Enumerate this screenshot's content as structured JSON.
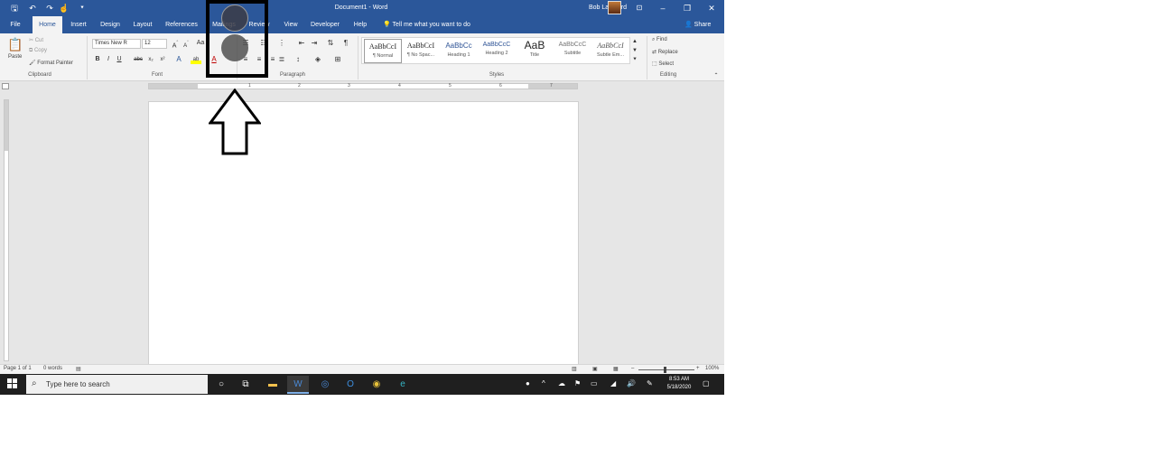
{
  "window": {
    "doc_title": "Document1  -  Word",
    "user_name": "Bob LanMord",
    "controls": {
      "minimize": "–",
      "restore": "❐",
      "close": "✕"
    }
  },
  "qat": {
    "save": "🖫",
    "undo": "↶",
    "redo": "↷",
    "touch": "☝",
    "customize": "⯆"
  },
  "tabs": [
    {
      "label": "File"
    },
    {
      "label": "Home"
    },
    {
      "label": "Insert"
    },
    {
      "label": "Design"
    },
    {
      "label": "Layout"
    },
    {
      "label": "References"
    },
    {
      "label": "Mailings"
    },
    {
      "label": "Review"
    },
    {
      "label": "View"
    },
    {
      "label": "Developer"
    },
    {
      "label": "Help"
    }
  ],
  "tell_me": "Tell me what you want to do",
  "share": "Share",
  "ribbon": {
    "clipboard": {
      "label": "Clipboard",
      "paste": "Paste",
      "cut": "Cut",
      "copy": "Copy",
      "format_painter": "Format Painter"
    },
    "font": {
      "label": "Font",
      "font_name": "Times New R",
      "font_size": "12",
      "bold": "B",
      "italic": "I",
      "underline": "U",
      "strike": "abc",
      "subscript": "x₂",
      "superscript": "x²"
    },
    "paragraph": {
      "label": "Paragraph"
    },
    "styles": {
      "label": "Styles",
      "items": [
        {
          "sample": "AaBbCcI",
          "name": "¶ Normal"
        },
        {
          "sample": "AaBbCcI",
          "name": "¶ No Spac..."
        },
        {
          "sample": "AaBbCc",
          "name": "Heading 1"
        },
        {
          "sample": "AaBbCcC",
          "name": "Heading 2"
        },
        {
          "sample": "AaB",
          "name": "Title"
        },
        {
          "sample": "AaBbCcC",
          "name": "Subtitle"
        },
        {
          "sample": "AaBbCcI",
          "name": "Subtle Em..."
        }
      ]
    },
    "editing": {
      "label": "Editing",
      "find": "Find",
      "replace": "Replace",
      "select": "Select"
    }
  },
  "ruler_numbers": [
    "1",
    "2",
    "3",
    "4",
    "5",
    "6",
    "7"
  ],
  "status": {
    "page": "Page 1 of 1",
    "words": "0 words",
    "zoom": "100%",
    "zoom_level": 0.5
  },
  "taskbar": {
    "search_placeholder": "Type here to search",
    "time": "8:53 AM",
    "date": "5/18/2020"
  }
}
